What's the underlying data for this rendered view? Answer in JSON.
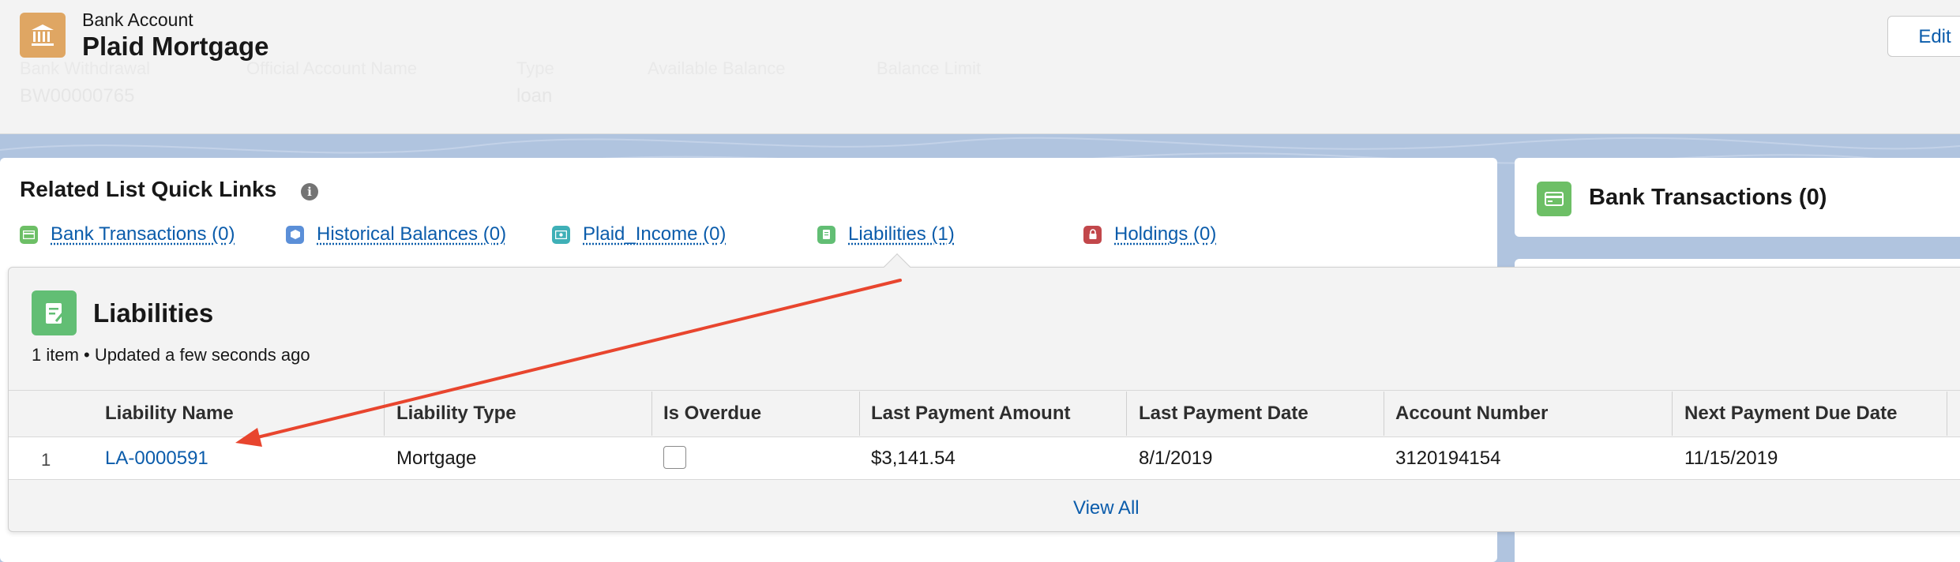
{
  "header": {
    "object_label": "Bank Account",
    "record_name": "Plaid Mortgage",
    "edit_label": "Edit",
    "fields": [
      {
        "label": "Bank Withdrawal",
        "value": "BW00000765"
      },
      {
        "label": "Official Account Name",
        "value": ""
      },
      {
        "label": "Type",
        "value": "loan"
      },
      {
        "label": "Available Balance",
        "value": ""
      },
      {
        "label": "Balance Limit",
        "value": ""
      }
    ]
  },
  "quick_links": {
    "title": "Related List Quick Links",
    "info_glyph": "i",
    "links": [
      {
        "label": "Bank Transactions (0)",
        "icon": "bank-transactions-icon",
        "color": "#6dbf66"
      },
      {
        "label": "Historical Balances (0)",
        "icon": "historical-balances-icon",
        "color": "#5b8fd8"
      },
      {
        "label": "Plaid_Income (0)",
        "icon": "plaid-income-icon",
        "color": "#3fb0b7"
      },
      {
        "label": "Liabilities (1)",
        "icon": "liabilities-icon",
        "color": "#62be74"
      },
      {
        "label": "Holdings (0)",
        "icon": "holdings-icon",
        "color": "#c2474b"
      }
    ]
  },
  "right_card": {
    "title": "Bank Transactions (0)",
    "color": "#6dbf66"
  },
  "popover": {
    "title": "Liabilities",
    "subtitle": "1 item • Updated a few seconds ago",
    "columns": [
      "Liability Name",
      "Liability Type",
      "Is Overdue",
      "Last Payment Amount",
      "Last Payment Date",
      "Account Number",
      "Next Payment Due Date"
    ],
    "rows": [
      {
        "num": "1",
        "liability_name": "LA-0000591",
        "liability_type": "Mortgage",
        "is_overdue": false,
        "last_payment_amount": "$3,141.54",
        "last_payment_date": "8/1/2019",
        "account_number": "3120194154",
        "next_payment_due_date": "11/15/2019"
      }
    ],
    "view_all_label": "View All"
  },
  "annotation": {
    "arrow_color": "#e8452e"
  }
}
